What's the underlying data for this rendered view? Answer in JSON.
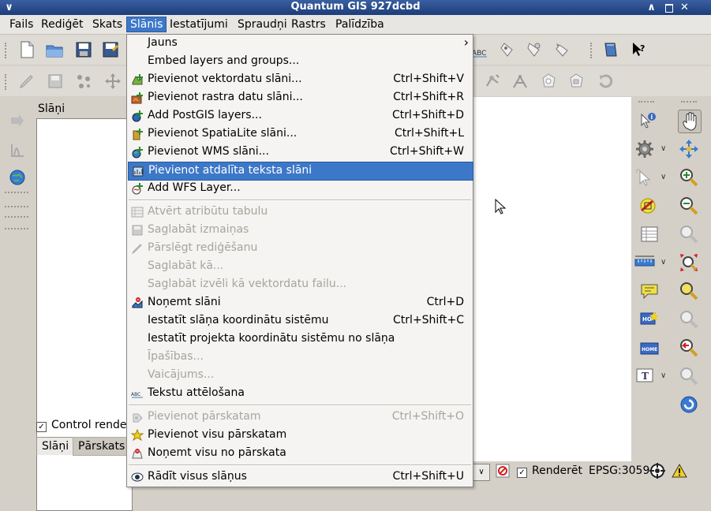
{
  "window": {
    "title": "Quantum GIS 927dcbd"
  },
  "menubar": {
    "items": [
      {
        "label": "Fails"
      },
      {
        "label": "Rediģēt"
      },
      {
        "label": "Skats"
      },
      {
        "label": "Slānis"
      },
      {
        "label": "Iestatījumi"
      },
      {
        "label": "Spraudņi"
      },
      {
        "label": "Rastrs"
      },
      {
        "label": "Palīdzība"
      }
    ],
    "active": "Slānis"
  },
  "menu": {
    "items": [
      {
        "label": "Jauns",
        "shortcut": "",
        "icon": "submenu",
        "disabled": false
      },
      {
        "label": "Embed layers and groups...",
        "shortcut": "",
        "icon": "",
        "disabled": false
      },
      {
        "label": "Pievienot vektordatu slāni...",
        "shortcut": "Ctrl+Shift+V",
        "icon": "add-vector-icon",
        "disabled": false
      },
      {
        "label": "Pievienot rastra datu slāni...",
        "shortcut": "Ctrl+Shift+R",
        "icon": "add-raster-icon",
        "disabled": false
      },
      {
        "label": "Add PostGIS layers...",
        "shortcut": "Ctrl+Shift+D",
        "icon": "add-postgis-icon",
        "disabled": false
      },
      {
        "label": "Pievienot SpatiaLite slāni...",
        "shortcut": "Ctrl+Shift+L",
        "icon": "add-spatialite-icon",
        "disabled": false
      },
      {
        "label": "Pievienot WMS slāni...",
        "shortcut": "Ctrl+Shift+W",
        "icon": "add-wms-icon",
        "disabled": false
      },
      {
        "label": "Pievienot atdalīta teksta slāni",
        "shortcut": "",
        "icon": "add-delimited-text-icon",
        "disabled": false
      },
      {
        "label": "Add WFS Layer...",
        "shortcut": "",
        "icon": "add-wfs-icon",
        "disabled": false
      },
      {
        "label": "Atvērt atribūtu tabulu",
        "shortcut": "",
        "icon": "attribute-table-icon",
        "disabled": true
      },
      {
        "label": "Saglabāt izmaiņas",
        "shortcut": "",
        "icon": "save-edits-icon",
        "disabled": true
      },
      {
        "label": "Pārslēgt rediģēšanu",
        "shortcut": "",
        "icon": "toggle-edit-icon",
        "disabled": true
      },
      {
        "label": "Saglabāt kā...",
        "shortcut": "",
        "icon": "",
        "disabled": true
      },
      {
        "label": "Saglabāt izvēli kā vektordatu failu...",
        "shortcut": "",
        "icon": "",
        "disabled": true
      },
      {
        "label": "Noņemt slāni",
        "shortcut": "Ctrl+D",
        "icon": "remove-layer-icon",
        "disabled": false
      },
      {
        "label": "Iestatīt slāņa koordinātu sistēmu",
        "shortcut": "Ctrl+Shift+C",
        "icon": "",
        "disabled": false
      },
      {
        "label": "Iestatīt projekta koordinātu sistēmu no slāņa",
        "shortcut": "",
        "icon": "",
        "disabled": false
      },
      {
        "label": "Īpašības...",
        "shortcut": "",
        "icon": "",
        "disabled": true
      },
      {
        "label": "Vaicājums...",
        "shortcut": "",
        "icon": "",
        "disabled": true
      },
      {
        "label": "Tekstu attēlošana",
        "shortcut": "",
        "icon": "labeling-icon",
        "disabled": false
      },
      {
        "label": "Pievienot pārskatam",
        "shortcut": "Ctrl+Shift+O",
        "icon": "add-overview-icon",
        "disabled": true
      },
      {
        "label": "Pievienot visu pārskatam",
        "shortcut": "",
        "icon": "add-all-overview-icon",
        "disabled": false
      },
      {
        "label": "Noņemt visu no pārskata",
        "shortcut": "",
        "icon": "remove-all-overview-icon",
        "disabled": false
      },
      {
        "label": "Rādīt visus slāņus",
        "shortcut": "Ctrl+Shift+U",
        "icon": "show-all-layers-icon",
        "disabled": false
      }
    ],
    "highlighted": "Pievienot atdalīta teksta slāni"
  },
  "panel": {
    "title": "Slāņi",
    "control_render_label": "Control rende",
    "control_render_checked": true,
    "tabs": [
      {
        "label": "Slāņi"
      },
      {
        "label": "Pārskats"
      }
    ]
  },
  "statusbar": {
    "render_label": "Renderēt",
    "render_checked": true,
    "crs": "EPSG:3059"
  },
  "colors": {
    "accent": "#3d78c8",
    "titlebar": "#1c3d7a",
    "disabled_text": "#a8a49e"
  }
}
